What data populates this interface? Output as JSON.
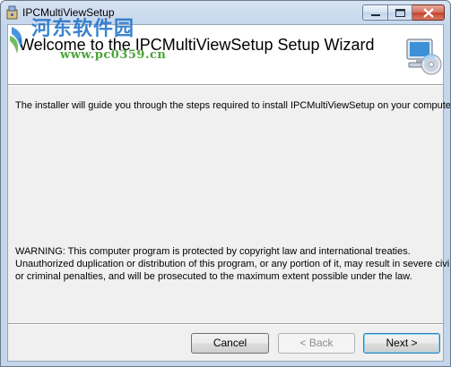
{
  "window": {
    "title": "IPCMultiViewSetup",
    "controls": [
      "minimize-icon",
      "maximize-icon",
      "close-icon"
    ]
  },
  "banner": {
    "title": "Welcome to the IPCMultiViewSetup Setup Wizard",
    "icon": "computer-cd-icon"
  },
  "watermark": {
    "site_name": "河东软件园",
    "url": "www.pc0359.cn"
  },
  "body": {
    "intro": "The installer will guide you through the steps required to install IPCMultiViewSetup on your computer.",
    "warning_lines": [
      "WARNING: This computer program is protected by copyright law and international treaties.",
      "Unauthorized duplication or distribution of this program, or any portion of it, may result in severe civil",
      "or criminal penalties, and will be prosecuted to the maximum extent possible under the law."
    ]
  },
  "buttons": {
    "cancel": "Cancel",
    "back": "< Back",
    "next": "Next >"
  }
}
